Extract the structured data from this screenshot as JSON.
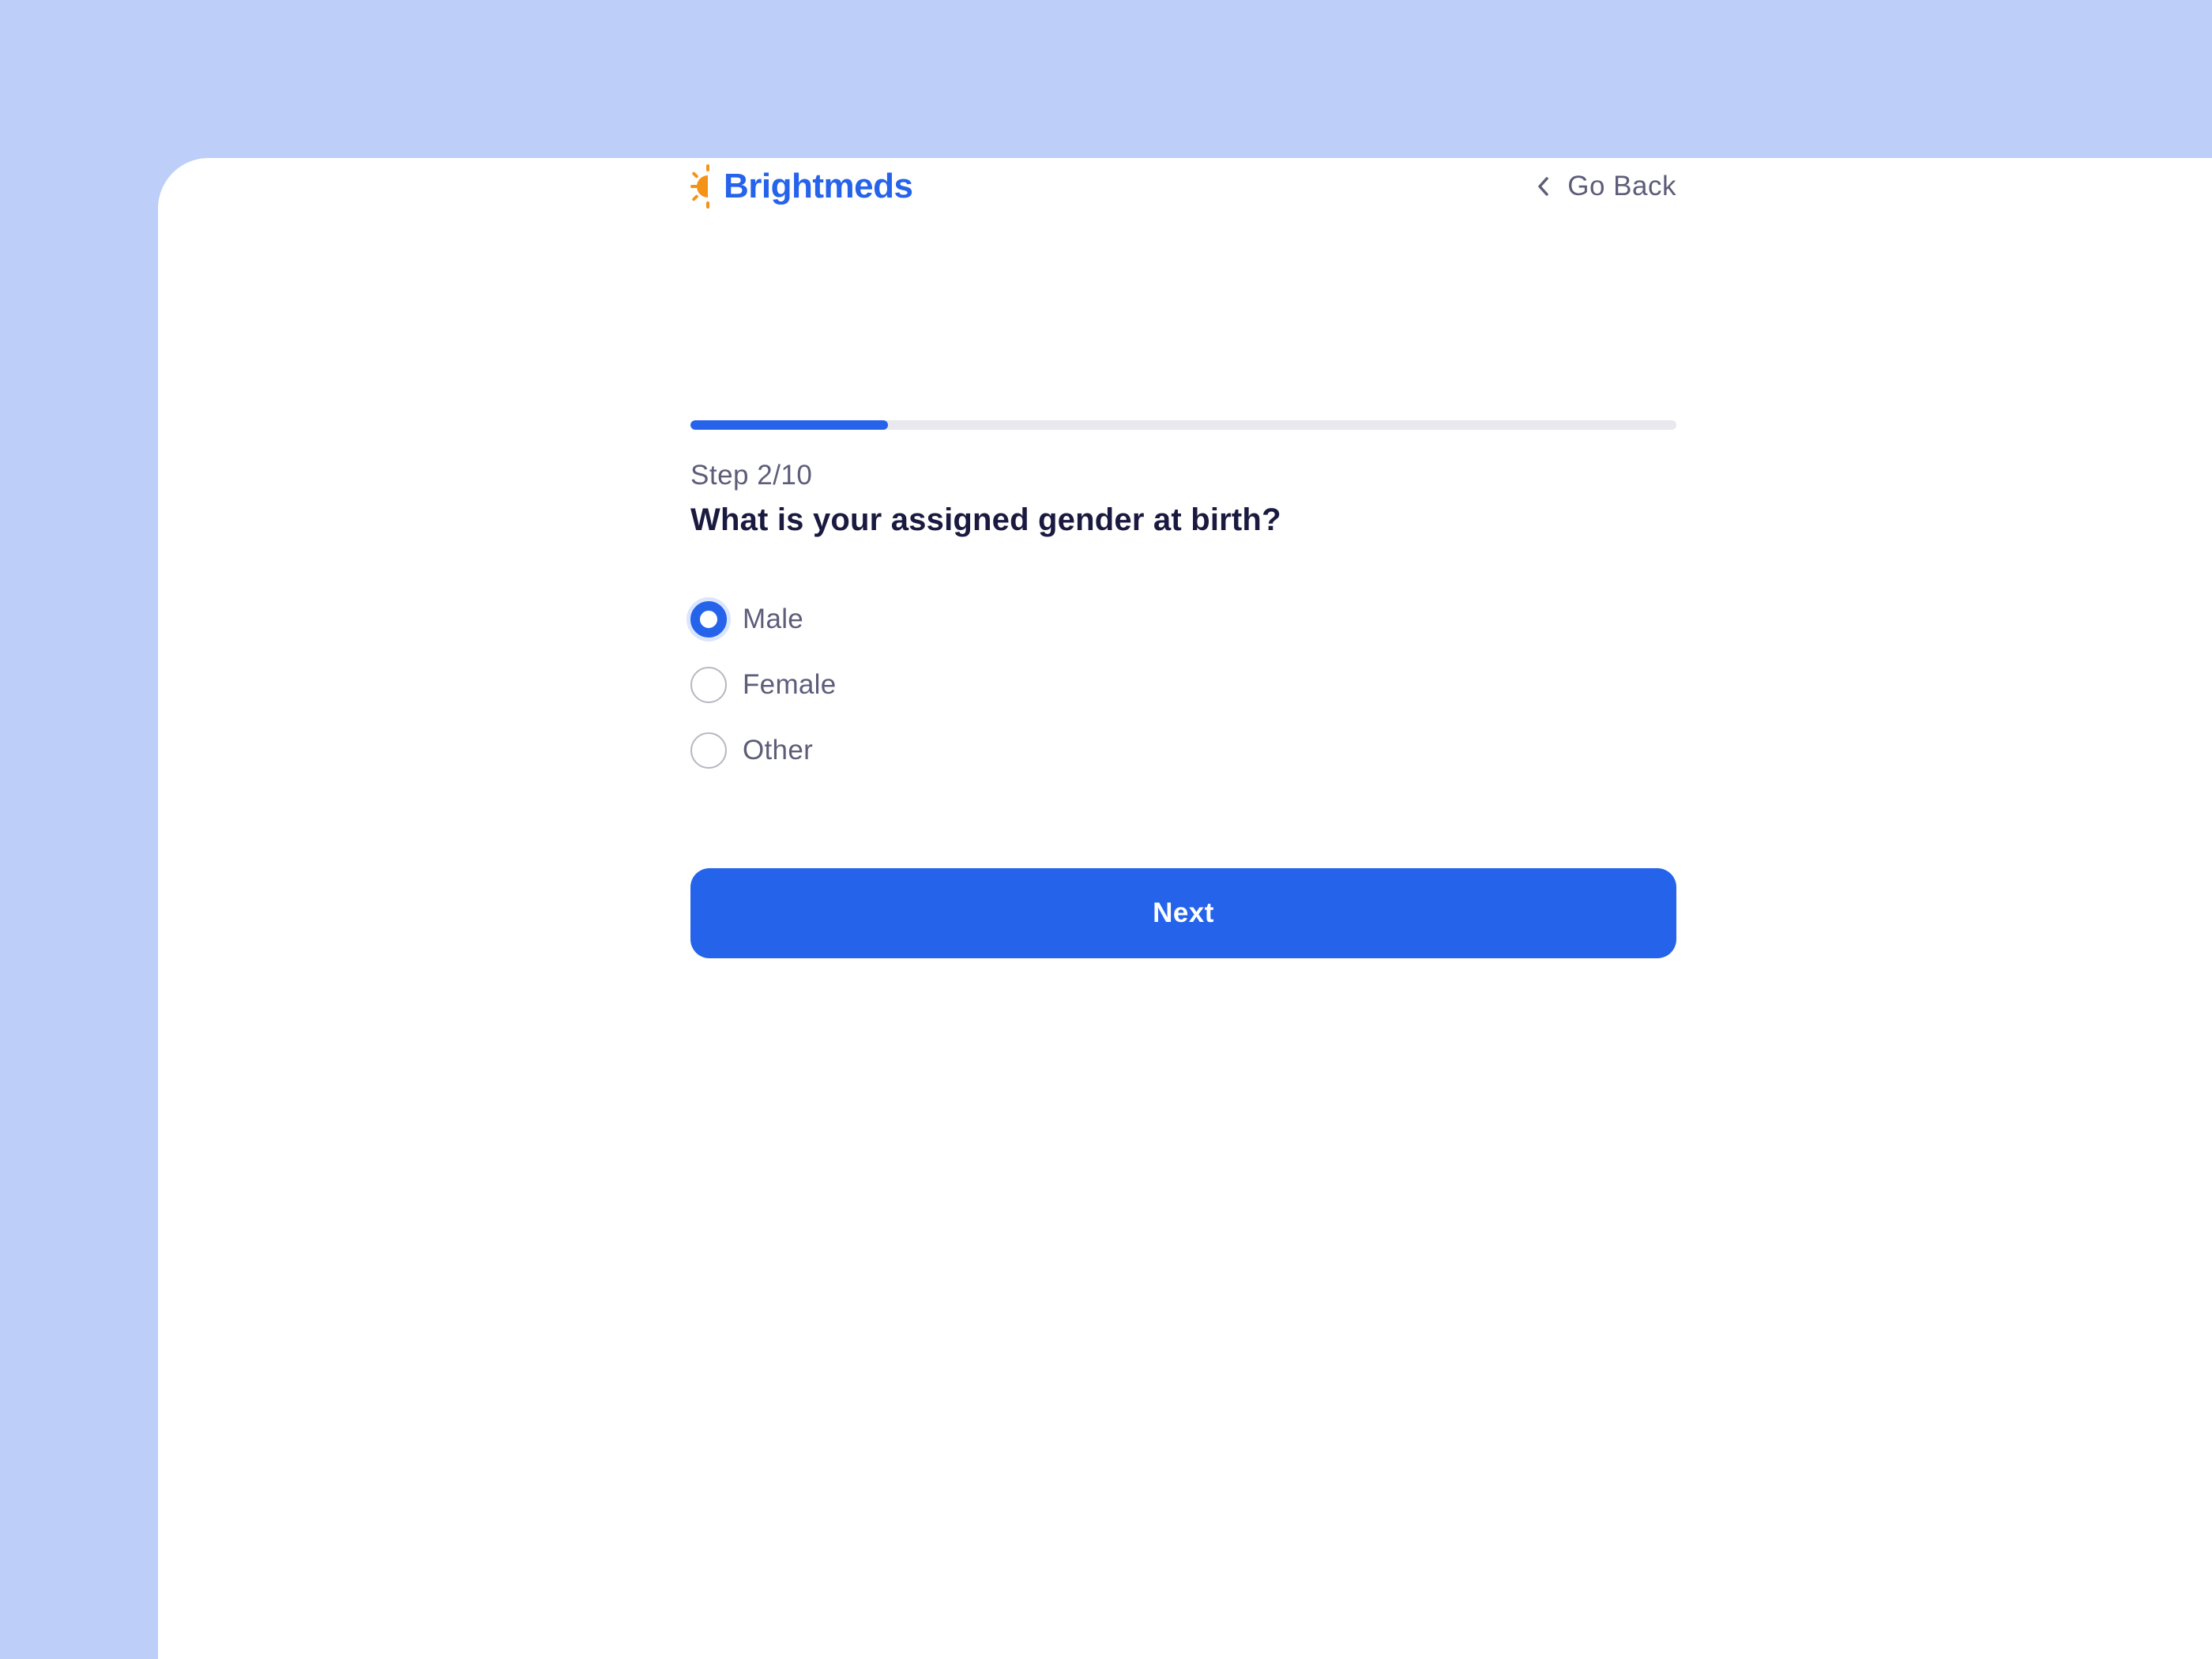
{
  "brand": {
    "name": "Brightmeds",
    "icon": "sun-logo-icon",
    "brand_color": "#2563eb",
    "icon_color": "#f59218"
  },
  "nav": {
    "back_label": "Go Back",
    "back_icon": "chevron-left-icon"
  },
  "progress": {
    "current_step": 2,
    "total_steps": 10,
    "fill_fraction": 0.2
  },
  "step_label": "Step 2/10",
  "question": "What is your assigned gender at birth?",
  "options": [
    {
      "label": "Male",
      "selected": true
    },
    {
      "label": "Female",
      "selected": false
    },
    {
      "label": "Other",
      "selected": false
    }
  ],
  "next_label": "Next",
  "colors": {
    "page_background": "#bdcff8",
    "card_background": "#ffffff",
    "accent": "#2563eb",
    "heading": "#1a1a40",
    "muted_text": "#5d5d7a"
  }
}
